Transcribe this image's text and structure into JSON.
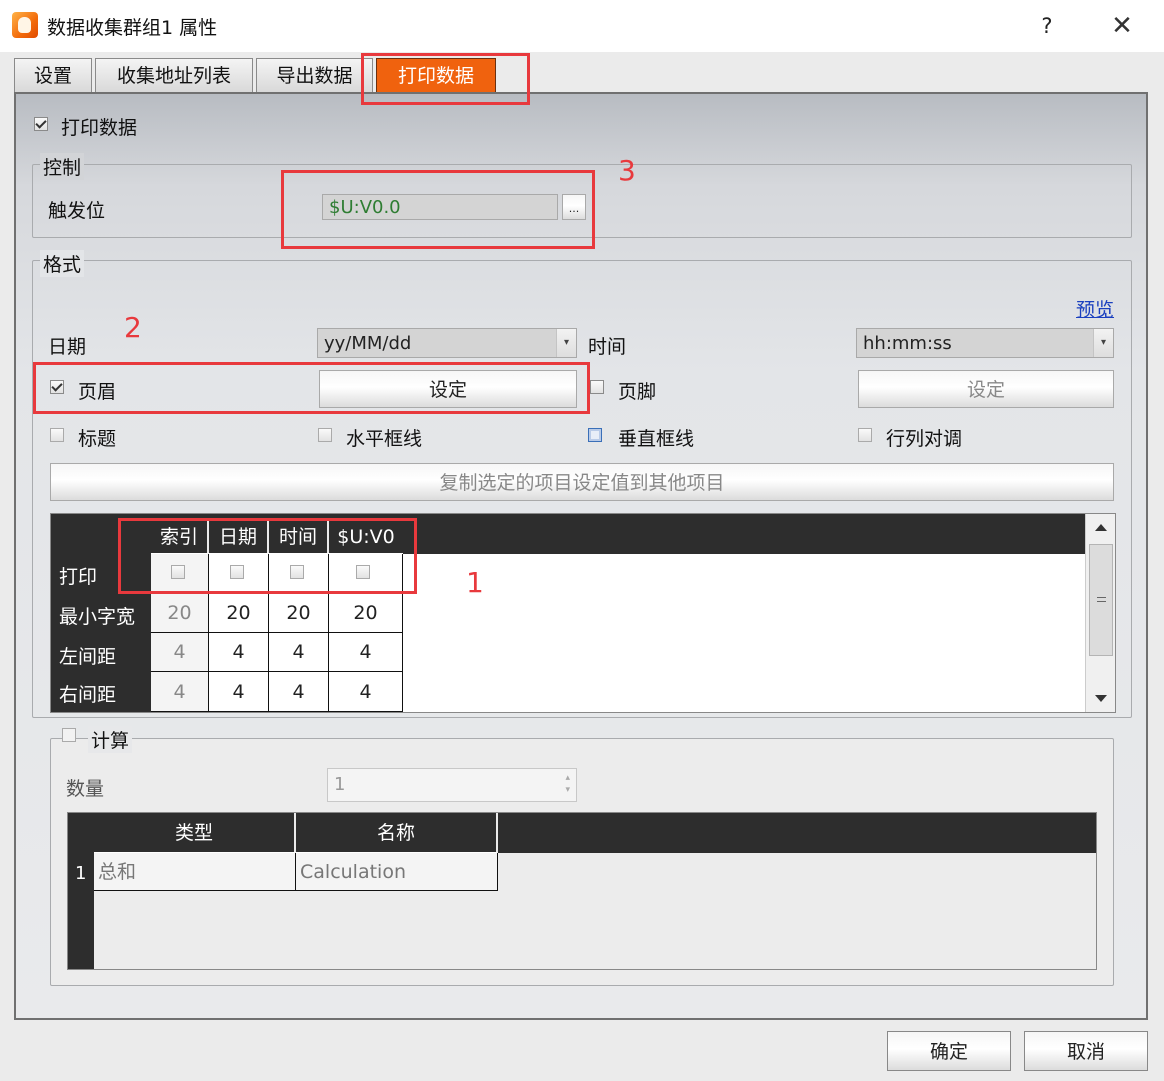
{
  "window": {
    "title": "数据收集群组1 属性",
    "help_label": "?",
    "close_label": "✕"
  },
  "tabs": [
    {
      "label": "设置",
      "active": false
    },
    {
      "label": "收集地址列表",
      "active": false
    },
    {
      "label": "导出数据",
      "active": false
    },
    {
      "label": "打印数据",
      "active": true
    }
  ],
  "print_data": {
    "enable_label": "打印数据",
    "enabled": true
  },
  "control": {
    "title": "控制",
    "trigger_label": "触发位",
    "trigger_value": "$U:V0.0",
    "browse_label": "..."
  },
  "format": {
    "title": "格式",
    "preview_link": "预览",
    "date_label": "日期",
    "date_value": "yy/MM/dd",
    "time_label": "时间",
    "time_value": "hh:mm:ss",
    "header_label": "页眉",
    "header_checked": true,
    "header_set_label": "设定",
    "footer_label": "页脚",
    "footer_checked": false,
    "footer_set_label": "设定",
    "title_check_label": "标题",
    "hline_label": "水平框线",
    "vline_label": "垂直框线",
    "swap_label": "行列对调",
    "copy_button_label": "复制选定的项目设定值到其他项目"
  },
  "column_grid": {
    "columns": [
      "索引",
      "日期",
      "时间",
      "$U:V0"
    ],
    "rows": [
      {
        "label": "打印",
        "values": [
          "",
          "",
          "",
          ""
        ]
      },
      {
        "label": "最小字宽",
        "values": [
          "20",
          "20",
          "20",
          "20"
        ]
      },
      {
        "label": "左间距",
        "values": [
          "4",
          "4",
          "4",
          "4"
        ]
      },
      {
        "label": "右间距",
        "values": [
          "4",
          "4",
          "4",
          "4"
        ]
      }
    ]
  },
  "calculation": {
    "title": "计算",
    "enabled": false,
    "count_label": "数量",
    "count_value": "1",
    "table_headers": [
      "类型",
      "名称"
    ],
    "rows": [
      {
        "index": "1",
        "type": "总和",
        "name": "Calculation"
      }
    ]
  },
  "footer_buttons": {
    "ok_label": "确定",
    "cancel_label": "取消"
  },
  "annotations": {
    "n1": "1",
    "n2": "2",
    "n3": "3"
  },
  "colors": {
    "active_tab": "#f0620e",
    "annotation": "#e8393d",
    "trigger_text": "#2e7d32",
    "link": "#1a3fbf"
  }
}
